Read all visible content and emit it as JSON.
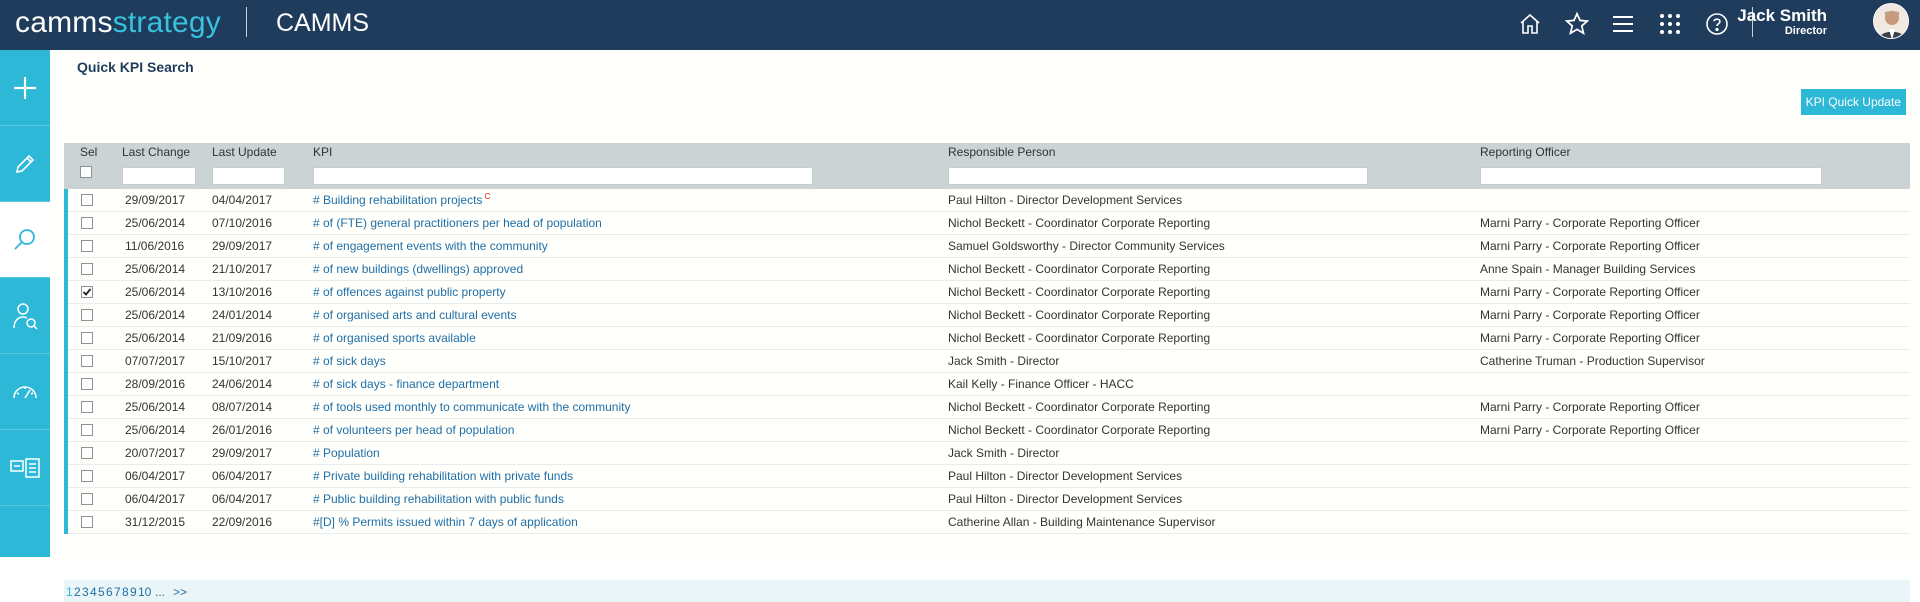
{
  "header": {
    "logo_part1": "camms",
    "logo_part2": "strategy",
    "app_name": "CAMMS",
    "icons": [
      "home-icon",
      "star-icon",
      "menu-icon",
      "apps-grid-icon",
      "help-icon"
    ],
    "user_name": "Jack Smith",
    "user_role": "Director",
    "colors": {
      "bar": "#1f3c5c",
      "accent": "#37c2de"
    }
  },
  "sidebar": {
    "items": [
      {
        "icon": "plus-icon",
        "active": false
      },
      {
        "icon": "pencil-icon",
        "active": false
      },
      {
        "icon": "search-icon",
        "active": true
      },
      {
        "icon": "user-search-icon",
        "active": false
      },
      {
        "icon": "gauge-icon",
        "active": false
      },
      {
        "icon": "report-icon",
        "active": false
      }
    ],
    "color": "#2cb8d6"
  },
  "page": {
    "title": "Quick KPI Search",
    "quick_update_label": "KPI Quick Update"
  },
  "grid": {
    "columns": [
      "Sel",
      "Last Change",
      "Last Update",
      "KPI",
      "Responsible Person",
      "Reporting Officer"
    ],
    "rows": [
      {
        "checked": false,
        "last_change": "29/09/2017",
        "last_update": "04/04/2017",
        "kpi": "# Building rehabilitation projects",
        "kpi_flag": "C",
        "responsible": "Paul Hilton - Director Development Services",
        "officer": ""
      },
      {
        "checked": false,
        "last_change": "25/06/2014",
        "last_update": "07/10/2016",
        "kpi": "# of (FTE) general practitioners per head of population",
        "kpi_flag": "",
        "responsible": "Nichol Beckett - Coordinator Corporate Reporting",
        "officer": "Marni Parry - Corporate Reporting Officer"
      },
      {
        "checked": false,
        "last_change": "11/06/2016",
        "last_update": "29/09/2017",
        "kpi": "# of engagement events with the community",
        "kpi_flag": "",
        "responsible": "Samuel Goldsworthy - Director Community Services",
        "officer": "Marni Parry - Corporate Reporting Officer"
      },
      {
        "checked": false,
        "last_change": "25/06/2014",
        "last_update": "21/10/2017",
        "kpi": "# of new buildings (dwellings) approved",
        "kpi_flag": "",
        "responsible": "Nichol Beckett - Coordinator Corporate Reporting",
        "officer": "Anne Spain - Manager Building Services"
      },
      {
        "checked": true,
        "last_change": "25/06/2014",
        "last_update": "13/10/2016",
        "kpi": "# of offences against public property",
        "kpi_flag": "",
        "responsible": "Nichol Beckett - Coordinator Corporate Reporting",
        "officer": "Marni Parry - Corporate Reporting Officer"
      },
      {
        "checked": false,
        "last_change": "25/06/2014",
        "last_update": "24/01/2014",
        "kpi": "# of organised arts and cultural events",
        "kpi_flag": "",
        "responsible": "Nichol Beckett - Coordinator Corporate Reporting",
        "officer": "Marni Parry - Corporate Reporting Officer"
      },
      {
        "checked": false,
        "last_change": "25/06/2014",
        "last_update": "21/09/2016",
        "kpi": "# of organised sports available",
        "kpi_flag": "",
        "responsible": "Nichol Beckett - Coordinator Corporate Reporting",
        "officer": "Marni Parry - Corporate Reporting Officer"
      },
      {
        "checked": false,
        "last_change": "07/07/2017",
        "last_update": "15/10/2017",
        "kpi": "# of sick days",
        "kpi_flag": "",
        "responsible": "Jack Smith - Director",
        "officer": "Catherine Truman - Production Supervisor"
      },
      {
        "checked": false,
        "last_change": "28/09/2016",
        "last_update": "24/06/2014",
        "kpi": "# of sick days - finance department",
        "kpi_flag": "",
        "responsible": "Kail Kelly - Finance Officer - HACC",
        "officer": ""
      },
      {
        "checked": false,
        "last_change": "25/06/2014",
        "last_update": "08/07/2014",
        "kpi": "# of tools used monthly to communicate with the community",
        "kpi_flag": "",
        "responsible": "Nichol Beckett - Coordinator Corporate Reporting",
        "officer": "Marni Parry - Corporate Reporting Officer"
      },
      {
        "checked": false,
        "last_change": "25/06/2014",
        "last_update": "26/01/2016",
        "kpi": "# of volunteers per head of population",
        "kpi_flag": "",
        "responsible": "Nichol Beckett - Coordinator Corporate Reporting",
        "officer": "Marni Parry - Corporate Reporting Officer"
      },
      {
        "checked": false,
        "last_change": "20/07/2017",
        "last_update": "29/09/2017",
        "kpi": "# Population",
        "kpi_flag": "",
        "responsible": "Jack Smith - Director",
        "officer": ""
      },
      {
        "checked": false,
        "last_change": "06/04/2017",
        "last_update": "06/04/2017",
        "kpi": "# Private building rehabilitation with private funds",
        "kpi_flag": "",
        "responsible": "Paul Hilton - Director Development Services",
        "officer": ""
      },
      {
        "checked": false,
        "last_change": "06/04/2017",
        "last_update": "06/04/2017",
        "kpi": "# Public building rehabilitation with public funds",
        "kpi_flag": "",
        "responsible": "Paul Hilton - Director Development Services",
        "officer": ""
      },
      {
        "checked": false,
        "last_change": "31/12/2015",
        "last_update": "22/09/2016",
        "kpi": "#[D] % Permits issued within 7 days of application",
        "kpi_flag": "",
        "responsible": "Catherine Allan - Building Maintenance Supervisor",
        "officer": ""
      }
    ],
    "pager": [
      "1",
      "2",
      "3",
      "4",
      "5",
      "6",
      "7",
      "8",
      "9",
      "10",
      "...",
      ">>"
    ],
    "current_page": "1"
  }
}
